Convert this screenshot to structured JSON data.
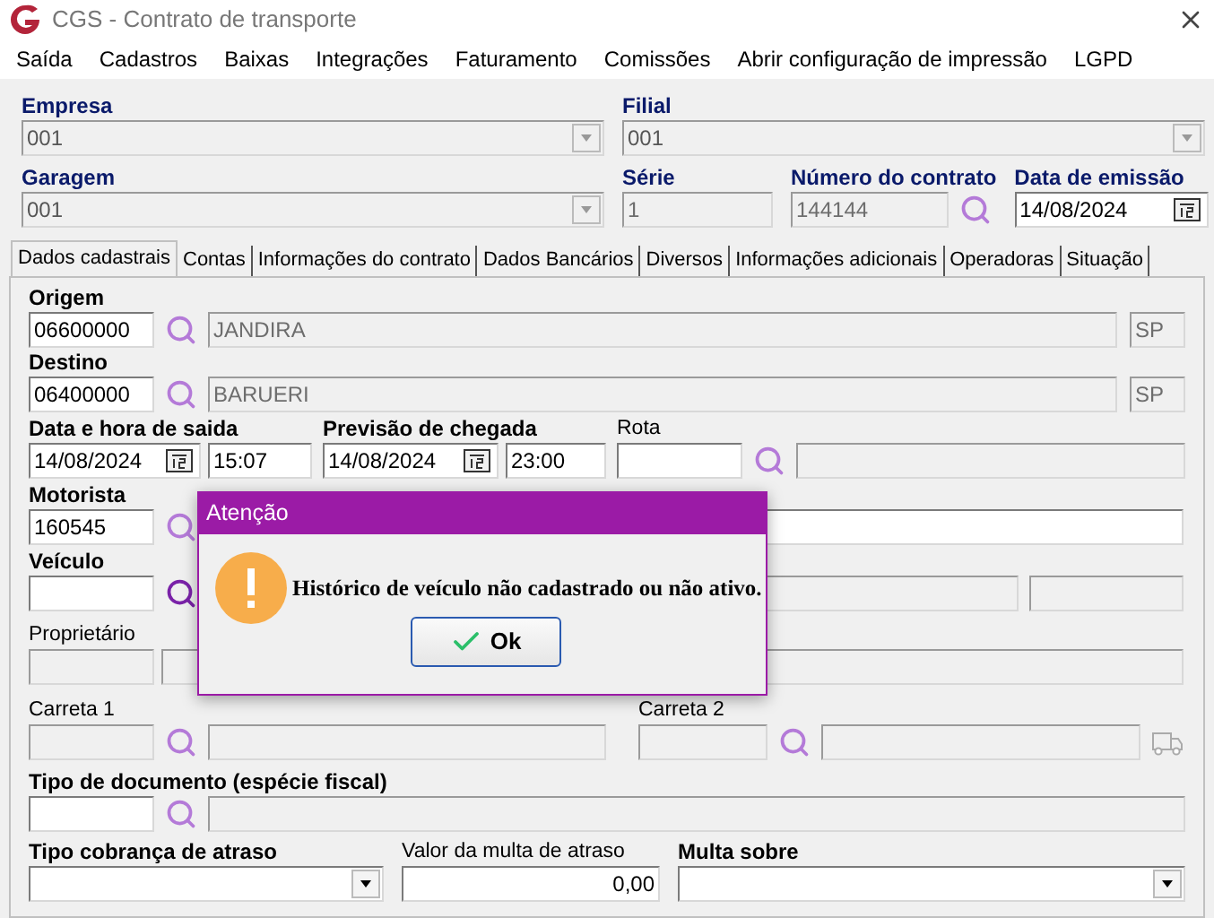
{
  "window": {
    "title": "CGS - Contrato de transporte"
  },
  "menu": [
    "Saída",
    "Cadastros",
    "Baixas",
    "Integrações",
    "Faturamento",
    "Comissões",
    "Abrir configuração de impressão",
    "LGPD"
  ],
  "header": {
    "empresa": {
      "label": "Empresa",
      "value": "001"
    },
    "filial": {
      "label": "Filial",
      "value": "001"
    },
    "garagem": {
      "label": "Garagem",
      "value": "001"
    },
    "serie": {
      "label": "Série",
      "value": "1"
    },
    "numero": {
      "label": "Número do contrato",
      "value": "144144"
    },
    "emissao": {
      "label": "Data de emissão",
      "value": "14/08/2024"
    }
  },
  "tabs": [
    {
      "label": "Dados cadastrais",
      "selected": true
    },
    {
      "label": "Contas",
      "selected": false
    },
    {
      "label": "Informações do contrato",
      "selected": false
    },
    {
      "label": "Dados Bancários",
      "selected": false
    },
    {
      "label": "Diversos",
      "selected": false
    },
    {
      "label": "Informações adicionais",
      "selected": false
    },
    {
      "label": "Operadoras",
      "selected": false
    },
    {
      "label": "Situação",
      "selected": false
    }
  ],
  "form": {
    "origem": {
      "label": "Origem",
      "code": "06600000",
      "city": "JANDIRA",
      "uf": "SP"
    },
    "destino": {
      "label": "Destino",
      "code": "06400000",
      "city": "BARUERI",
      "uf": "SP"
    },
    "saida": {
      "label": "Data e hora de saida",
      "date": "14/08/2024",
      "time": "15:07"
    },
    "chegada": {
      "label": "Previsão de chegada",
      "date": "14/08/2024",
      "time": "23:00"
    },
    "rota": {
      "label": "Rota"
    },
    "motorista": {
      "label": "Motorista",
      "code": "160545"
    },
    "veiculo": {
      "label": "Veículo"
    },
    "proprietario": {
      "label": "Proprietário"
    },
    "carreta1": {
      "label": "Carreta 1"
    },
    "carreta2": {
      "label": "Carreta 2"
    },
    "tipo_documento": {
      "label": "Tipo de documento (espécie fiscal)"
    },
    "tipo_cobranca": {
      "label": "Tipo cobrança de atraso"
    },
    "valor_multa": {
      "label": "Valor da multa de atraso",
      "value": "0,00"
    },
    "multa_sobre": {
      "label": "Multa sobre"
    }
  },
  "dialog": {
    "title": "Atenção",
    "message": "Histórico de veículo não cadastrado ou não ativo.",
    "button": "Ok"
  }
}
